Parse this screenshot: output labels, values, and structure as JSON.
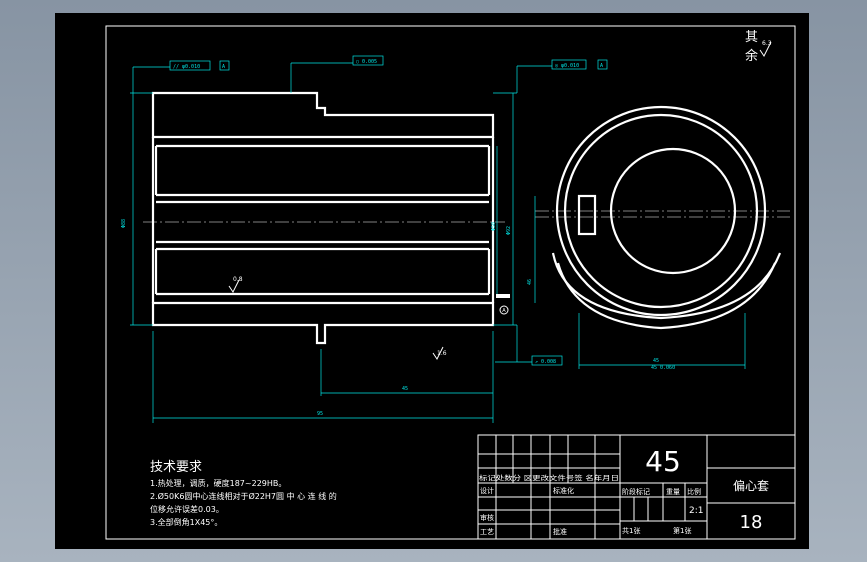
{
  "drawing": {
    "roughness_other": "其余",
    "roughness_other_value": "6.3",
    "roughness_bore": "0.8",
    "roughness_chamfer": "1.6",
    "tol_parallel": "// φ0.010",
    "tol_round": "○ 0.005",
    "tol_coax": "◎ φ0.010",
    "tol_runout": "↗ 0.008",
    "datum": "A",
    "dim_length_total": "95",
    "dim_length_step": "45",
    "dim_outer_dia": "Φ88",
    "dim_bore_dia": "Φ50",
    "dim_right_dia": "Φ92",
    "dim_keyway": "46",
    "dim_circle_bottom": "45",
    "dim_circle_bottom2": "45 0.060"
  },
  "notes": {
    "title": "技术要求",
    "line1": "1.热处理，调质，硬度187~229HB。",
    "line2": "2.Ø50K6圆中心连线相对于Ø22H7圆 中 心 连 线 的",
    "line3": "位移允许误差0.03。",
    "line4": "3.全部倒角1X45°。"
  },
  "title_block": {
    "material": "45",
    "part_name": "偏心套",
    "drawing_no": "18",
    "row_header": "标记处数分 区更改文件号签 名年月日",
    "designer": "设计",
    "standardize": "标准化",
    "stage_mark": "阶段标记",
    "weight": "重量",
    "scale": "比例",
    "scale_value": "2:1",
    "review": "审核",
    "process": "工艺",
    "approve": "批准",
    "sheets_total": "共1张",
    "sheet_no": "第1张"
  }
}
